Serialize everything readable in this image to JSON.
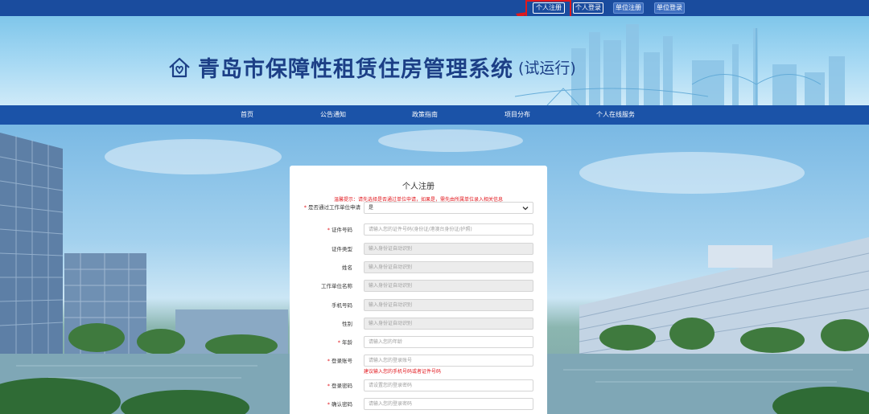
{
  "topbar": {
    "buttons": [
      {
        "label": "个人注册",
        "style": "outline",
        "highlighted": true
      },
      {
        "label": "个人登录",
        "style": "outline"
      },
      {
        "label": "单位注册",
        "style": "solid"
      },
      {
        "label": "单位登录",
        "style": "solid"
      }
    ]
  },
  "header": {
    "title": "青岛市保障性租赁住房管理系统",
    "title_suffix": "(试运行)"
  },
  "nav": {
    "items": [
      "首页",
      "公告通知",
      "政策指南",
      "项目分布",
      "个人在线服务"
    ]
  },
  "form": {
    "title": "个人注册",
    "tip": "温馨提示：请先选择是否通过单位申请，如果是，需先由所属单位录入相关信息",
    "fields": [
      {
        "label": "是否通过工作单位申请",
        "required": true,
        "type": "select",
        "value": "是"
      },
      {
        "label": "证件号码",
        "required": true,
        "placeholder": "请输入您的证件号码(身份证/港澳台身份证/护照)"
      },
      {
        "label": "证件类型",
        "required": false,
        "placeholder": "输入身份证自动识别",
        "disabled": true
      },
      {
        "label": "姓名",
        "required": false,
        "placeholder": "输入身份证自动识别",
        "disabled": true
      },
      {
        "label": "工作单位名称",
        "required": false,
        "placeholder": "输入身份证自动识别",
        "disabled": true
      },
      {
        "label": "手机号码",
        "required": false,
        "placeholder": "输入身份证自动识别",
        "disabled": true
      },
      {
        "label": "性别",
        "required": false,
        "placeholder": "输入身份证自动识别",
        "disabled": true
      },
      {
        "label": "年龄",
        "required": true,
        "placeholder": "请输入您的年龄"
      },
      {
        "label": "登录账号",
        "required": true,
        "placeholder": "请输入您的登录账号",
        "hint": "建议输入您的手机号码或者证件号码"
      },
      {
        "label": "登录密码",
        "required": true,
        "placeholder": "请设置您的登录密码"
      },
      {
        "label": "确认密码",
        "required": true,
        "placeholder": "请输入您的登录密码"
      }
    ]
  },
  "colors": {
    "topbar": "#1a4c9e",
    "nav": "#1b53a8",
    "highlight": "#e0191c",
    "required": "#e2191f",
    "title": "#1c3f86"
  }
}
